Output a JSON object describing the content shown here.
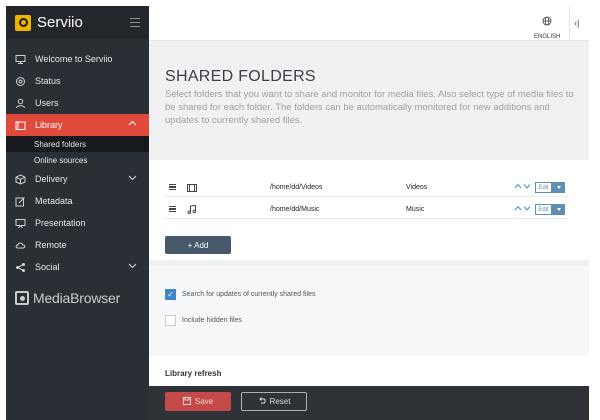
{
  "app": {
    "name": "Serviio"
  },
  "sidebar": {
    "items": [
      {
        "label": "Welcome to Serviio",
        "icon": "monitor-icon"
      },
      {
        "label": "Status",
        "icon": "radar-icon"
      },
      {
        "label": "Users",
        "icon": "user-icon"
      },
      {
        "label": "Library",
        "icon": "folder-icon",
        "active": true
      },
      {
        "label": "Delivery",
        "icon": "box-icon"
      },
      {
        "label": "Metadata",
        "icon": "edit-icon"
      },
      {
        "label": "Presentation",
        "icon": "presentation-icon"
      },
      {
        "label": "Remote",
        "icon": "cloud-icon"
      },
      {
        "label": "Social",
        "icon": "share-icon"
      }
    ],
    "library_sub": [
      "Shared folders",
      "Online sources"
    ],
    "partner": "MediaBrowser"
  },
  "topbar": {
    "language": "ENGLISH",
    "collapse_symbol": "‹|"
  },
  "page": {
    "title": "SHARED FOLDERS",
    "description": "Select folders that you want to share and monitor for media files. Also select type of media files to be shared for each folder. The folders can be automatically monitored for new additions and updates to currently shared files."
  },
  "folders": [
    {
      "path": "/home/dd/Videos",
      "type": "Videos",
      "type_icon": "film-icon",
      "edit": "Edit"
    },
    {
      "path": "/home/dd/Music",
      "type": "Music",
      "type_icon": "music-icon",
      "edit": "Edit"
    }
  ],
  "add_label": "+ Add",
  "options": {
    "search_updates": {
      "label": "Search for updates of currently shared files",
      "checked": true
    },
    "include_hidden": {
      "label": "Include hidden files",
      "checked": false
    }
  },
  "library_refresh": {
    "title": "Library refresh"
  },
  "footer": {
    "save": "Save",
    "reset": "Reset"
  },
  "colors": {
    "accent": "#e04a3b",
    "sidebar": "#2a2f35",
    "primary_button": "#46586a",
    "link": "#3a8fd4"
  }
}
